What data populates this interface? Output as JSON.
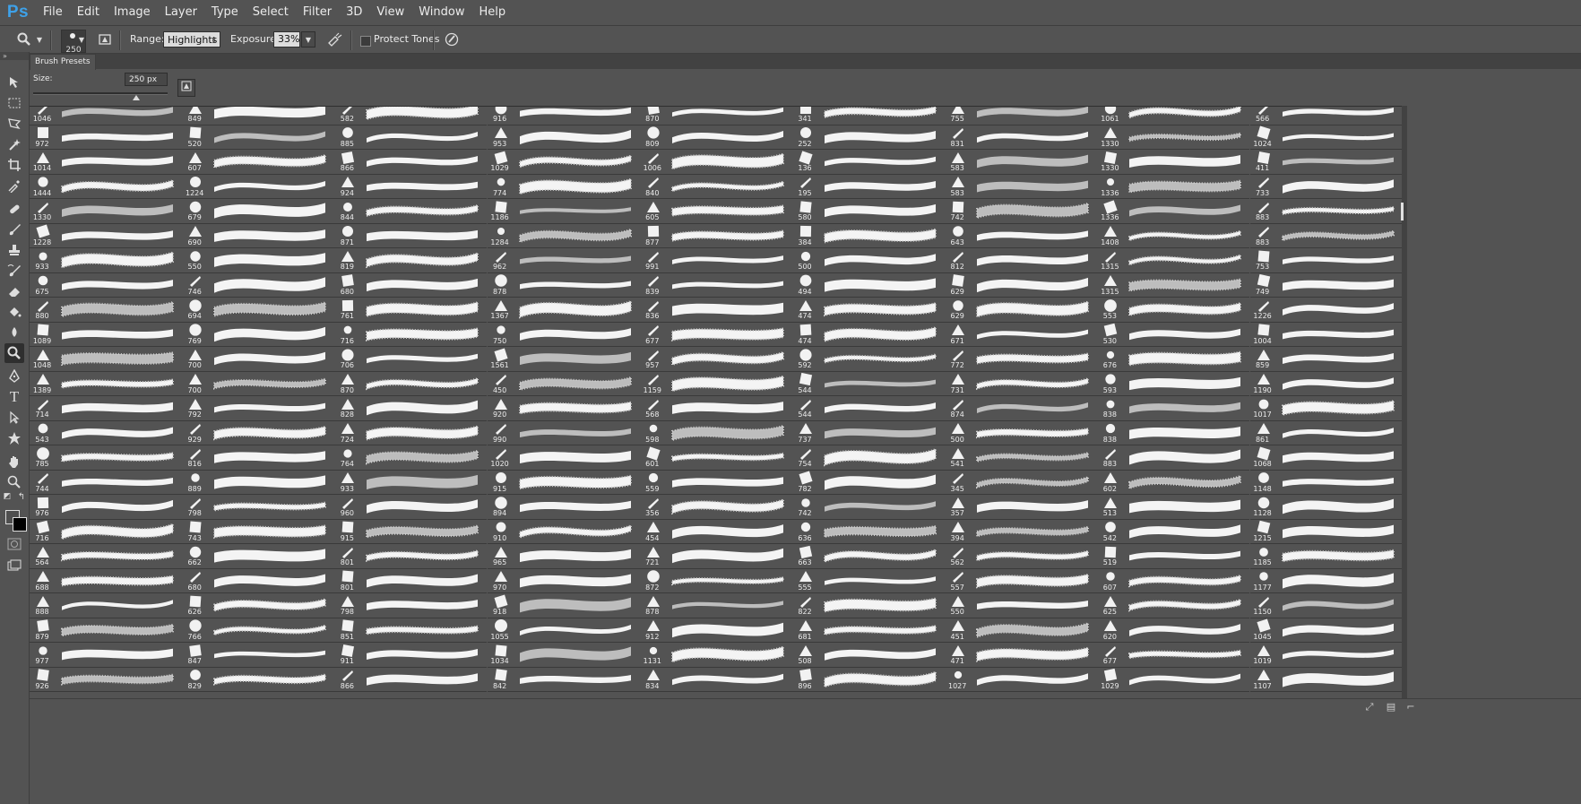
{
  "app": {
    "logo": "Ps"
  },
  "menu": [
    "File",
    "Edit",
    "Image",
    "Layer",
    "Type",
    "Select",
    "Filter",
    "3D",
    "View",
    "Window",
    "Help"
  ],
  "options": {
    "brush_size": "250",
    "range_label": "Range:",
    "range_value": "Highlights",
    "exposure_label": "Exposure:",
    "exposure_value": "33%",
    "protect_tones_label": "Protect Tones"
  },
  "panel": {
    "tab_label": "Brush Presets",
    "size_label": "Size:",
    "size_value": "250 px",
    "size_slider_level": 0.78
  },
  "columns": [
    [
      "1046",
      "972",
      "1014",
      "1444",
      "1330",
      "1228",
      "933",
      "675",
      "880",
      "1089",
      "1048",
      "1389",
      "714",
      "543",
      "785",
      "744",
      "976",
      "716",
      "564",
      "688",
      "888",
      "879",
      "977",
      "926"
    ],
    [
      "849",
      "520",
      "607",
      "1224",
      "679",
      "690",
      "550",
      "746",
      "694",
      "769",
      "700",
      "700",
      "792",
      "929",
      "816",
      "889",
      "798",
      "743",
      "662",
      "680",
      "626",
      "766",
      "847",
      "829"
    ],
    [
      "582",
      "885",
      "866",
      "924",
      "844",
      "871",
      "819",
      "680",
      "761",
      "716",
      "706",
      "870",
      "828",
      "724",
      "764",
      "933",
      "960",
      "915",
      "801",
      "801",
      "798",
      "851",
      "911",
      "866"
    ],
    [
      "916",
      "953",
      "1029",
      "774",
      "1186",
      "1284",
      "962",
      "878",
      "1367",
      "750",
      "1561",
      "450",
      "920",
      "990",
      "1020",
      "915",
      "894",
      "910",
      "965",
      "970",
      "918",
      "1055",
      "1034",
      "842"
    ],
    [
      "870",
      "809",
      "1006",
      "840",
      "605",
      "877",
      "991",
      "839",
      "836",
      "677",
      "957",
      "1159",
      "568",
      "598",
      "601",
      "559",
      "356",
      "454",
      "721",
      "872",
      "878",
      "912",
      "1131",
      "834"
    ],
    [
      "341",
      "252",
      "136",
      "195",
      "580",
      "384",
      "500",
      "494",
      "474",
      "474",
      "592",
      "544",
      "544",
      "737",
      "754",
      "782",
      "742",
      "636",
      "663",
      "555",
      "822",
      "681",
      "508",
      "896"
    ],
    [
      "755",
      "831",
      "583",
      "583",
      "742",
      "643",
      "812",
      "629",
      "629",
      "671",
      "772",
      "731",
      "874",
      "500",
      "541",
      "345",
      "357",
      "394",
      "562",
      "557",
      "550",
      "451",
      "471",
      "1027"
    ],
    [
      "1061",
      "1330",
      "1330",
      "1336",
      "1336",
      "1408",
      "1315",
      "1315",
      "553",
      "530",
      "676",
      "593",
      "838",
      "838",
      "883",
      "602",
      "513",
      "542",
      "519",
      "607",
      "625",
      "620",
      "677",
      "1029"
    ],
    [
      "566",
      "1024",
      "411",
      "733",
      "883",
      "883",
      "753",
      "749",
      "1226",
      "1004",
      "859",
      "1190",
      "1017",
      "861",
      "1068",
      "1148",
      "1128",
      "1215",
      "1185",
      "1177",
      "1150",
      "1045",
      "1019",
      "1107"
    ]
  ],
  "icons": {
    "zoom_tool": "zoom-icon",
    "airbrush": "airbrush-icon",
    "tablet_pressure": "pen-pressure-icon"
  }
}
